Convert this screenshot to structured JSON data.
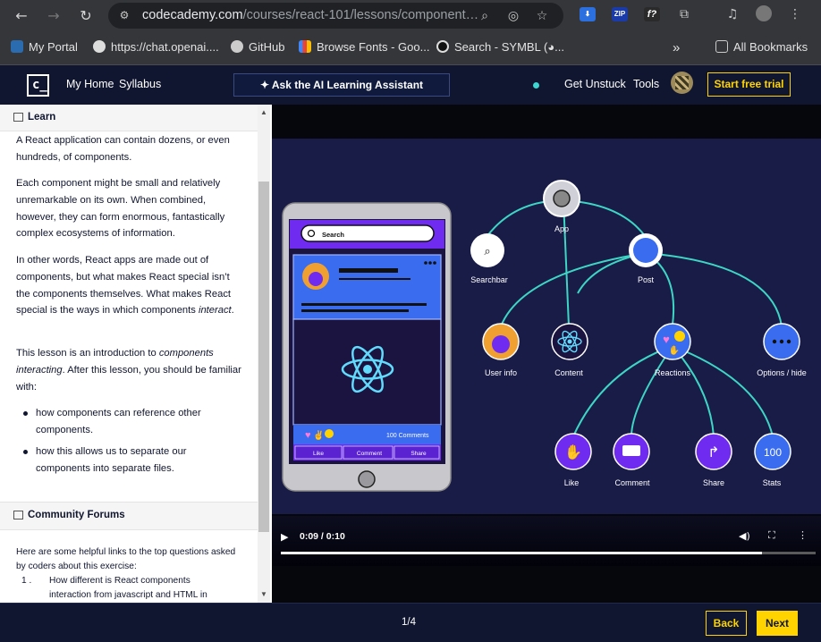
{
  "browser": {
    "url_domain": "codecademy.com",
    "url_path": "/courses/react-101/lessons/component…",
    "bookmarks": [
      "My Portal",
      "https://chat.openai....",
      "GitHub",
      "Browse Fonts - Goo...",
      "Search - SYMBL (◕..."
    ],
    "all_bookmarks": "All Bookmarks",
    "ext_zip": "ZIP",
    "ext_f": "f?"
  },
  "header": {
    "logo": "c_",
    "my_home": "My Home",
    "syllabus": "Syllabus",
    "ai_assistant": "Ask the AI Learning Assistant",
    "get_unstuck": "Get Unstuck",
    "tools": "Tools",
    "start_trial": "Start free trial"
  },
  "learn": {
    "title": "Learn",
    "p1": "A React application can contain dozens, or even hundreds, of components.",
    "p2": "Each component might be small and relatively unremarkable on its own. When combined, however, they can form enormous, fantastically complex ecosystems of information.",
    "p3a": "In other words, React apps are made out of components, but what makes React special isn’t the components themselves. What makes React special is the ways in which components ",
    "p3b": "interact",
    "p3c": ".",
    "p4a": "This lesson is an introduction to ",
    "p4b": "components interacting",
    "p4c": ". After this lesson, you should be familiar with:",
    "bullets": [
      "how components can reference other components.",
      "how this allows us to separate our components into separate files."
    ]
  },
  "forums": {
    "title": "Community Forums",
    "intro": "Here are some helpful links to the top questions asked by coders about this exercise:",
    "items": [
      {
        "num": "1 .",
        "text": "How different is React components interaction from javascript and HTML in"
      }
    ]
  },
  "video": {
    "time": "0:09 / 0:10",
    "progress": 0.9,
    "phone": {
      "search": "Search",
      "comments": "100 Comments",
      "like": "Like",
      "comment": "Comment",
      "share": "Share"
    },
    "tree": {
      "app": "App",
      "searchbar": "Searchbar",
      "post": "Post",
      "user_info": "User info",
      "content": "Content",
      "reactions": "Reactions",
      "options": "Options / hide",
      "like": "Like",
      "comment": "Comment",
      "share": "Share",
      "stats": "Stats",
      "stats_value": "100"
    }
  },
  "footer": {
    "page": "1/4",
    "back": "Back",
    "next": "Next"
  },
  "colors": {
    "accent_yellow": "#ffd300",
    "navy": "#10162f",
    "purple": "#6f2cf0",
    "teal": "#3dd6d0"
  }
}
